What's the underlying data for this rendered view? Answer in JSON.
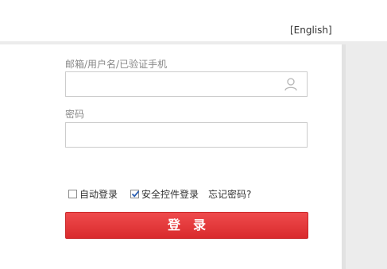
{
  "header": {
    "language_link": "[English]"
  },
  "login_form": {
    "account_label": "邮箱/用户名/已验证手机",
    "account_value": "",
    "account_icon": "user-icon",
    "password_label": "密码",
    "password_value": "",
    "auto_login_label": "自动登录",
    "auto_login_checked": false,
    "security_control_label": "安全控件登录",
    "security_control_checked": true,
    "forgot_password_link": "忘记密码?",
    "submit_label": "登录"
  },
  "colors": {
    "button_top": "#ef4b4d",
    "button_bottom": "#d92a2d",
    "frame_gray": "#ececec"
  }
}
